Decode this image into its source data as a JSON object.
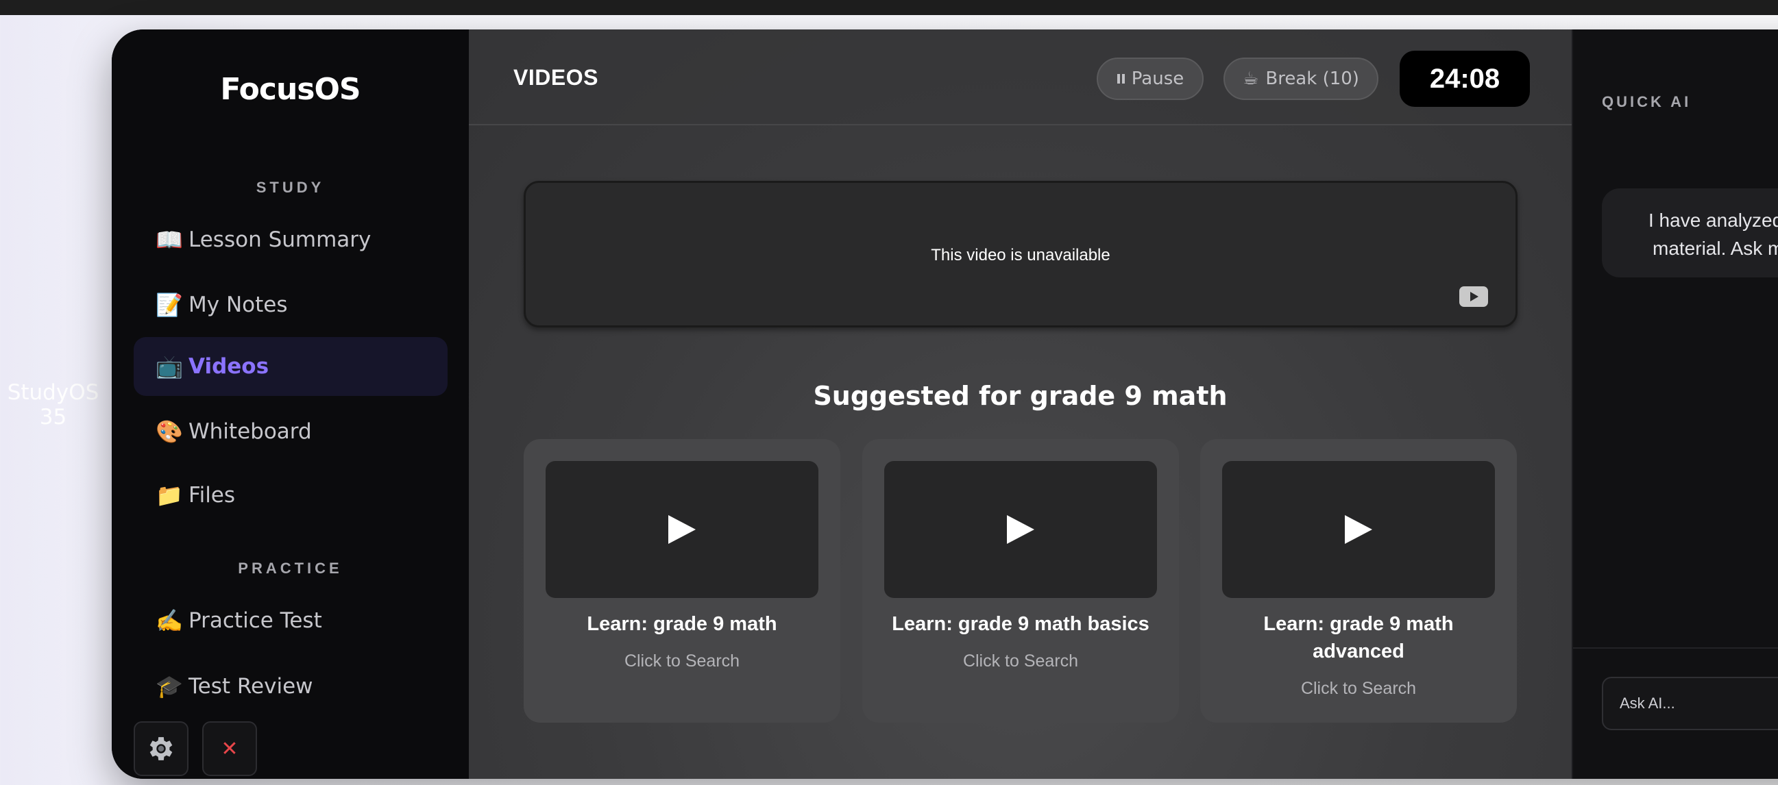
{
  "background": {
    "label_line1": "StudyOS",
    "label_line2": "35"
  },
  "sidebar": {
    "logo": "FocusOS",
    "sections": [
      {
        "label": "STUDY",
        "items": [
          {
            "emoji": "📖",
            "label": "Lesson Summary"
          },
          {
            "emoji": "📝",
            "label": "My Notes"
          },
          {
            "emoji": "📺",
            "label": "Videos",
            "active": true
          },
          {
            "emoji": "🎨",
            "label": "Whiteboard"
          },
          {
            "emoji": "📁",
            "label": "Files"
          }
        ]
      },
      {
        "label": "PRACTICE",
        "items": [
          {
            "emoji": "✍️",
            "label": "Practice Test"
          },
          {
            "emoji": "🎓",
            "label": "Test Review"
          }
        ]
      }
    ],
    "settings_icon": "gear-icon",
    "close_icon": "close-icon",
    "close_glyph": "✕"
  },
  "header": {
    "title": "VIDEOS",
    "pause_label": "Pause",
    "break_label": "Break (10)",
    "break_emoji": "☕",
    "timer": "24:08"
  },
  "player": {
    "message": "This video is unavailable"
  },
  "suggestions": {
    "title": "Suggested for grade 9 math",
    "cards": [
      {
        "title": "Learn: grade 9 math",
        "subtitle": "Click to Search"
      },
      {
        "title": "Learn: grade 9 math basics",
        "subtitle": "Click to Search"
      },
      {
        "title": "Learn: grade 9 math advanced",
        "subtitle": "Click to Search"
      }
    ]
  },
  "quick_ai": {
    "label": "QUICK AI",
    "message_line1": "I have analyzed",
    "message_line2": "material. Ask m",
    "input_placeholder": "Ask AI..."
  },
  "colors": {
    "accent": "#8b73ff",
    "sidebar_bg": "#0b0b0d",
    "main_bg": "#3b3b3d",
    "timer_bg": "#000000"
  }
}
